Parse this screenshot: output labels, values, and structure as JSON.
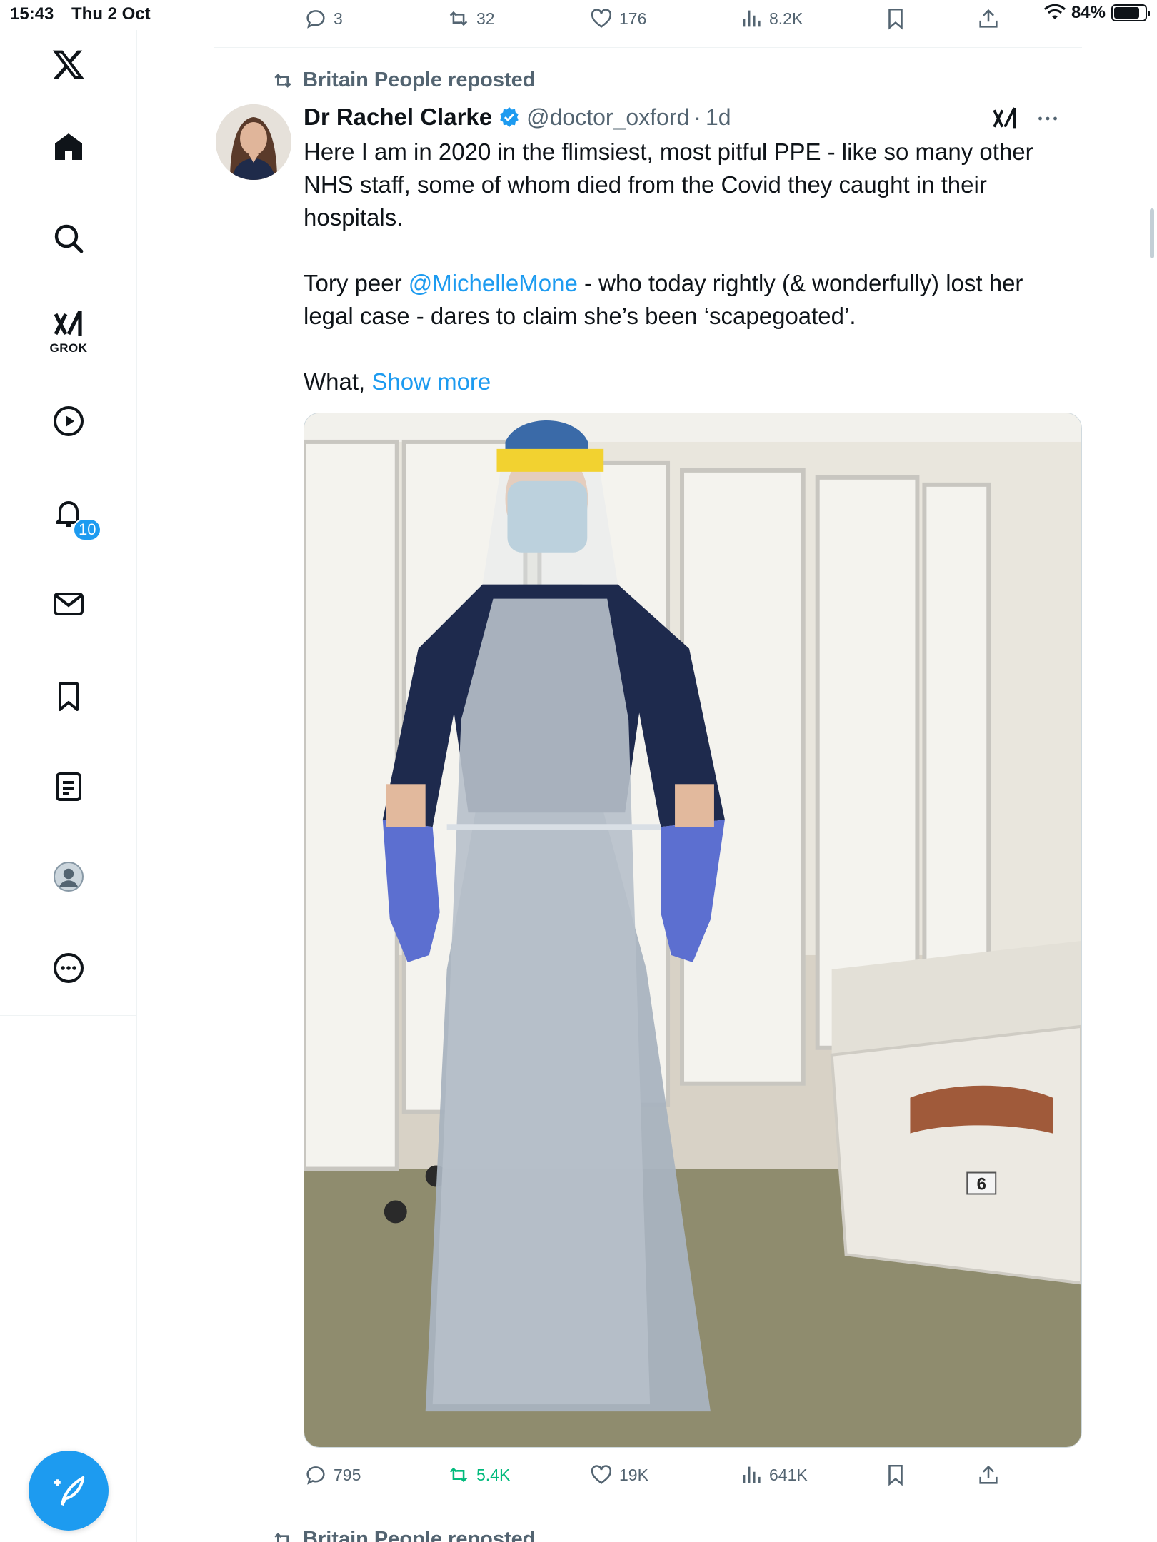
{
  "status_bar": {
    "time": "15:43",
    "date": "Thu 2 Oct",
    "battery": "84%",
    "battery_level": 0.84
  },
  "sidebar": {
    "logo": "x-logo-icon",
    "items": [
      {
        "icon": "home-icon"
      },
      {
        "icon": "search-icon"
      },
      {
        "icon": "grok-icon",
        "label": "GROK"
      },
      {
        "icon": "video-play-icon"
      },
      {
        "icon": "notifications-bell-icon",
        "badge": "10"
      },
      {
        "icon": "messages-envelope-icon"
      },
      {
        "icon": "bookmarks-icon"
      },
      {
        "icon": "lists-icon"
      },
      {
        "icon": "profile-avatar-icon"
      },
      {
        "icon": "more-icon"
      }
    ],
    "compose_icon": "compose-post-icon"
  },
  "prev_tweet_actions": {
    "replies": "3",
    "reposts": "32",
    "likes": "176",
    "views": "8.2K"
  },
  "tweet": {
    "repost_context": "Britain People reposted",
    "author_name": "Dr Rachel Clarke",
    "handle": "@doctor_oxford",
    "separator": "·",
    "age": "1d",
    "paragraph1": "Here I am in 2020 in the flimsiest, most pitful PPE - like so many other NHS staff, some of whom died from the Covid they caught in their hospitals.",
    "p2_prefix": "Tory peer ",
    "p2_mention": "@MichelleMone",
    "p2_suffix": " - who today rightly (& wonderfully) lost her legal case - dares to claim she’s been ‘scapegoated’.",
    "p3_prefix": "What, ",
    "show_more": "Show more",
    "photo_bed_number": "6",
    "actions": {
      "replies": "795",
      "reposts": "5.4K",
      "likes": "19K",
      "views": "641K"
    },
    "colors": {
      "accent": "#1d9bf0",
      "repost_active": "#00ba7c",
      "muted": "#536471"
    }
  },
  "next_tweet": {
    "repost_context": "Britain People reposted"
  }
}
